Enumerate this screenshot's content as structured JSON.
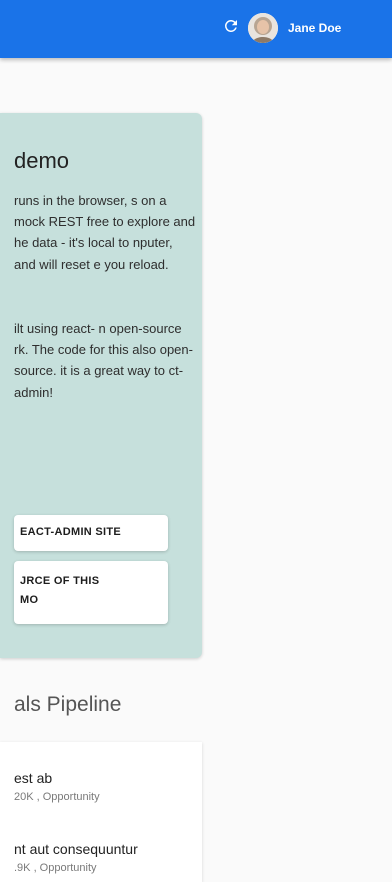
{
  "header": {
    "refresh_icon": "refresh-icon",
    "user": {
      "name": "Jane Doe",
      "avatar_icon": "user-avatar"
    }
  },
  "colors": {
    "appbar": "#1a73e8",
    "welcome_card": "#c6e0dc"
  },
  "welcome": {
    "title": "demo",
    "paragraphs": [
      "runs in the browser, s on a mock REST free to explore and he data - it's local to nputer, and will reset e you reload.",
      "ilt using react- n open-source rk. The code for this also open-source. it is a great way to ct-admin!"
    ],
    "buttons": [
      {
        "label": "EACT-ADMIN SITE"
      },
      {
        "label_line1": "JRCE OF THIS",
        "label_line2": "MO"
      }
    ]
  },
  "pipeline": {
    "title": "als Pipeline",
    "deals": [
      {
        "name": "est ab",
        "meta": "20K , Opportunity"
      },
      {
        "name": "nt aut consequuntur",
        "meta": ".9K , Opportunity"
      }
    ]
  }
}
